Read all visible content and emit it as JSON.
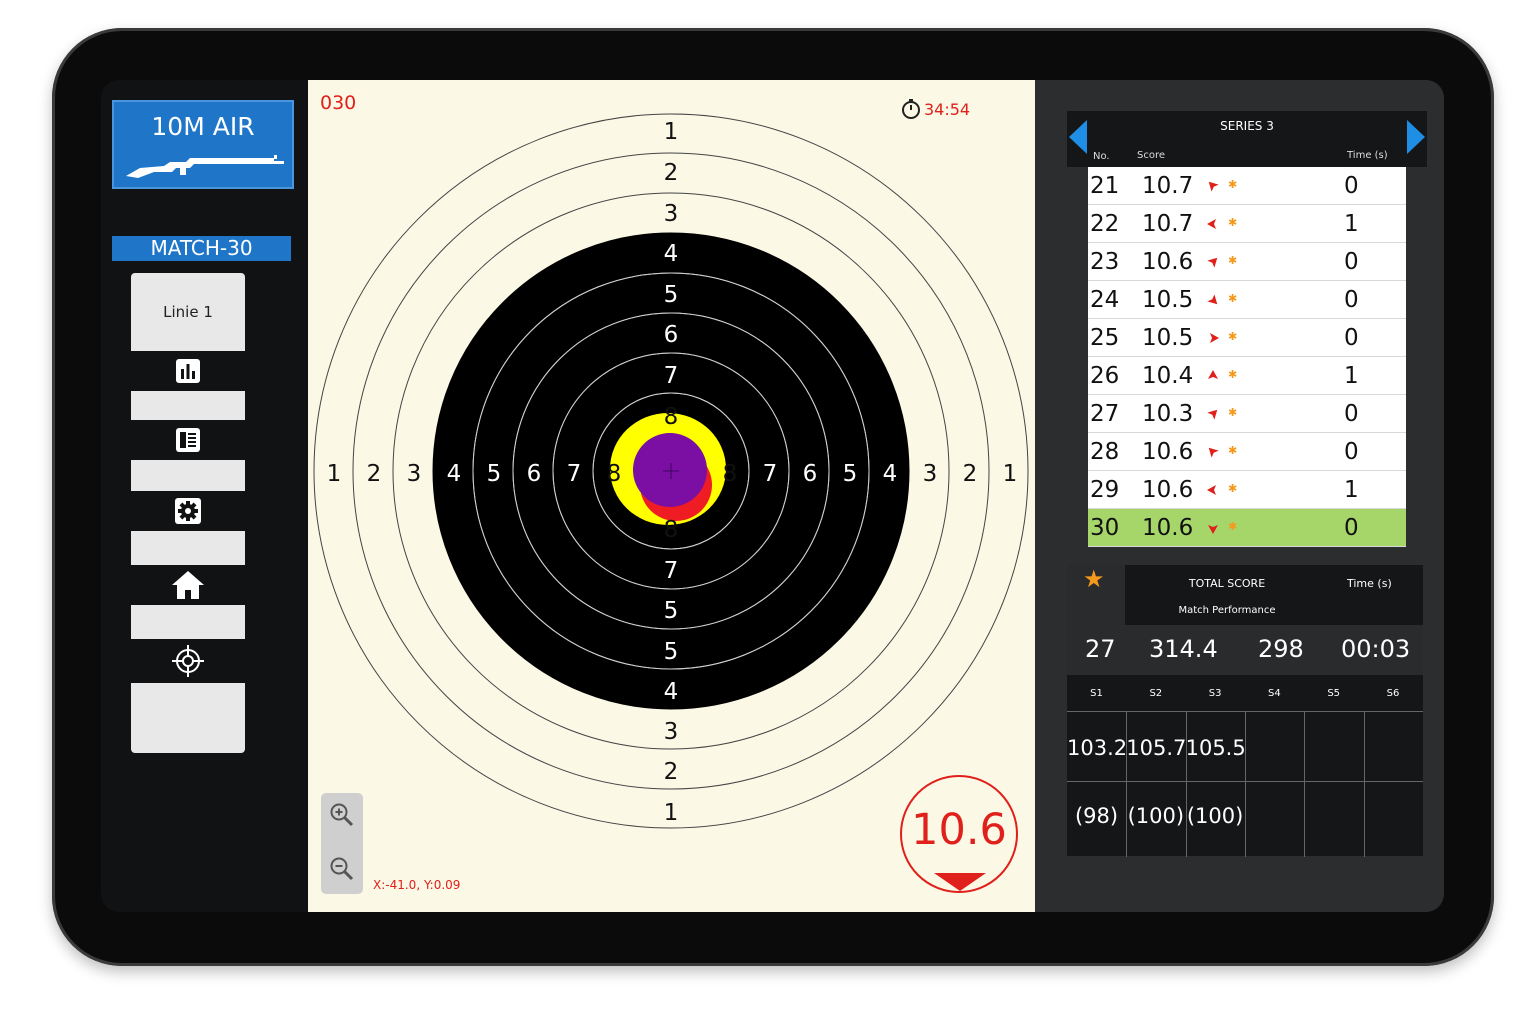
{
  "left": {
    "weapon_title": "10M AIR",
    "match_label": "MATCH-30",
    "lane_label": "Linie 1",
    "menu_icons": [
      "bar-chart-icon",
      "document-list-icon",
      "gear-icon",
      "home-icon",
      "crosshair-icon"
    ]
  },
  "target": {
    "shot_counter": "030",
    "timer": "34:54",
    "coordinates": "X:-41.0, Y:0.09",
    "last_score": "10.6",
    "ring_labels_vertical": [
      "1",
      "2",
      "3",
      "4",
      "5",
      "6",
      "7",
      "8",
      "8",
      "7",
      "5",
      "5",
      "4",
      "3",
      "2",
      "1"
    ],
    "ring_labels_horizontal": [
      "1",
      "2",
      "3",
      "4",
      "5",
      "6",
      "7",
      "8",
      "8",
      "7",
      "6",
      "5",
      "4",
      "3",
      "2",
      "1"
    ],
    "colors": {
      "accent": "#e0201b",
      "paper": "#fbf8e6",
      "group_yellow": "#ffff00",
      "group_purple": "#7b0ea3"
    }
  },
  "series": {
    "title": "SERIES 3",
    "col_no": "No.",
    "col_score": "Score",
    "col_time": "Time (s)",
    "shots": [
      {
        "no": "21",
        "score": "10.7",
        "time": "0",
        "dir": "up-left"
      },
      {
        "no": "22",
        "score": "10.7",
        "time": "1",
        "dir": "left"
      },
      {
        "no": "23",
        "score": "10.6",
        "time": "0",
        "dir": "up-right"
      },
      {
        "no": "24",
        "score": "10.5",
        "time": "0",
        "dir": "down-right"
      },
      {
        "no": "25",
        "score": "10.5",
        "time": "0",
        "dir": "right"
      },
      {
        "no": "26",
        "score": "10.4",
        "time": "1",
        "dir": "up"
      },
      {
        "no": "27",
        "score": "10.3",
        "time": "0",
        "dir": "up-right"
      },
      {
        "no": "28",
        "score": "10.6",
        "time": "0",
        "dir": "up-left"
      },
      {
        "no": "29",
        "score": "10.6",
        "time": "1",
        "dir": "left"
      },
      {
        "no": "30",
        "score": "10.6",
        "time": "0",
        "dir": "down"
      }
    ]
  },
  "total": {
    "title": "TOTAL SCORE",
    "time_label": "Time (s)",
    "performance_label": "Match Performance",
    "shots": "27",
    "score": "314.4",
    "performance": "298",
    "time": "00:03",
    "series_labels": [
      "S1",
      "S2",
      "S3",
      "S4",
      "S5",
      "S6"
    ],
    "series_scores": [
      "103.2",
      "105.7",
      "105.5",
      "",
      "",
      ""
    ],
    "series_integer": [
      "(98)",
      "(100)",
      "(100)",
      "",
      "",
      ""
    ]
  }
}
